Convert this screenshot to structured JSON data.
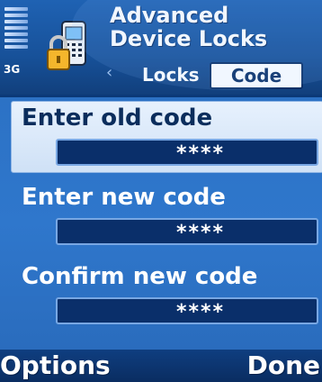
{
  "status": {
    "network": "3G",
    "signal_bars": 7
  },
  "header": {
    "title_line1": "Advanced",
    "title_line2": "Device Locks",
    "tabs": [
      {
        "label": "Locks",
        "selected": false
      },
      {
        "label": "Code",
        "selected": true
      }
    ]
  },
  "form": {
    "old_code_label": "Enter old code",
    "old_code_value": "****",
    "new_code_label": "Enter new code",
    "new_code_value": "****",
    "confirm_code_label": "Confirm new code",
    "confirm_code_value": "****"
  },
  "softkeys": {
    "left": "Options",
    "right": "Done"
  },
  "colors": {
    "header_blue": "#1f62b3",
    "content_blue": "#2f77cc",
    "field_box": "#0a2f6a",
    "selected_row": "#e7f1fd"
  }
}
